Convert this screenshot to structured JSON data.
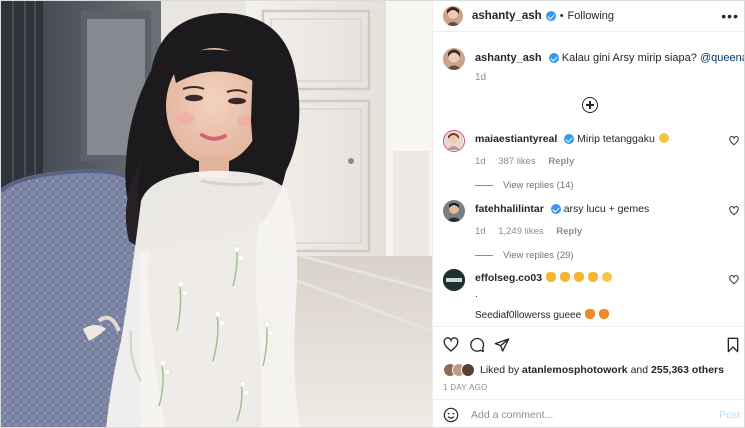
{
  "header": {
    "username": "ashanty_ash",
    "separator": "•",
    "follow_status": "Following",
    "more_icon": "more-horizontal-icon"
  },
  "caption": {
    "username": "ashanty_ash",
    "text": "Kalau gini Arsy mirip siapa?",
    "mention": "@queenarsy",
    "time": "1d"
  },
  "load_more_icon": "plus-circle-icon",
  "comments": [
    {
      "username": "maiaestiantyreal",
      "verified": true,
      "text": "Mirip tetanggaku",
      "emoji": "grinning-face-icon",
      "time": "1d",
      "likes": "387 likes",
      "reply_label": "Reply",
      "view_replies": "View replies (14)"
    },
    {
      "username": "fatehhalilintar",
      "verified": true,
      "text": "arsy lucu + gemes",
      "time": "1d",
      "likes": "1,249 likes",
      "reply_label": "Reply",
      "view_replies": "View replies (29)"
    },
    {
      "username": "effolseg.co03",
      "verified": false,
      "text": "",
      "emoji": "hands-and-thumbs-icons",
      "line2": ".",
      "line3": "Seediaf0llowerss gueee"
    }
  ],
  "actions": {
    "like_icon": "heart-icon",
    "comment_icon": "comment-icon",
    "share_icon": "send-icon",
    "save_icon": "bookmark-icon"
  },
  "likes_summary": {
    "prefix": "Liked by",
    "user": "atanlemosphotowork",
    "middle": "and",
    "count": "255,363 others"
  },
  "post_time": "1 DAY AGO",
  "add_comment": {
    "placeholder": "Add a comment...",
    "post_label": "Post",
    "emoji_icon": "smiley-icon"
  },
  "colors": {
    "verified": "#3897f0",
    "mention": "#00376b",
    "post_disabled": "#b2dffc",
    "muted": "#8e8e8e"
  }
}
